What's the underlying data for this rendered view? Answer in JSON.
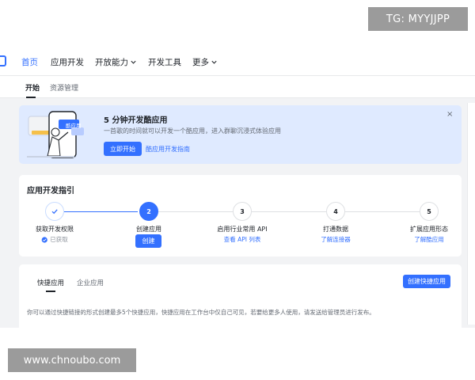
{
  "nav": {
    "items": [
      {
        "label": "首页",
        "active": true
      },
      {
        "label": "应用开发"
      },
      {
        "label": "开放能力",
        "dropdown": true
      },
      {
        "label": "开发工具"
      },
      {
        "label": "更多",
        "dropdown": true
      }
    ]
  },
  "subnav": {
    "tabs": [
      {
        "label": "开始",
        "active": true
      },
      {
        "label": "资源管理"
      }
    ]
  },
  "banner": {
    "title": "5 分钟开发酷应用",
    "description": "一首歌的时间就可以开发一个酷应用，进入群聊沉浸式体验应用",
    "primary_button": "立即开始",
    "link": "酷应用开发指南",
    "illustration_badge": "酷应用"
  },
  "guide": {
    "title": "应用开发指引",
    "steps": [
      {
        "number": "✓",
        "label": "获取开发权限",
        "sub": "已获取",
        "status": "done"
      },
      {
        "number": "2",
        "label": "创建应用",
        "sub": "创建",
        "status": "active"
      },
      {
        "number": "3",
        "label": "启用行业常用 API",
        "sub": "查看 API 列表",
        "status": "todo"
      },
      {
        "number": "4",
        "label": "打通数据",
        "sub": "了解连接器",
        "status": "todo"
      },
      {
        "number": "5",
        "label": "扩展应用形态",
        "sub": "了解酷应用",
        "status": "todo"
      }
    ]
  },
  "apps": {
    "tabs": [
      {
        "label": "快捷应用",
        "active": true
      },
      {
        "label": "企业应用"
      }
    ],
    "create_button": "创建快捷应用",
    "description": "你可以通过快捷链接的形式创建最多5个快捷应用，快捷应用在工作台中仅自己可见，若要给更多人使用，请发送给管理员进行发布。"
  },
  "watermarks": {
    "tg": "TG: MYYJJPP",
    "url": "www.chnoubo.com"
  },
  "colors": {
    "accent": "#3370ff",
    "banner_bg": "#dfeaff",
    "page_bg": "#f2f3f5",
    "success": "#3370ff"
  }
}
